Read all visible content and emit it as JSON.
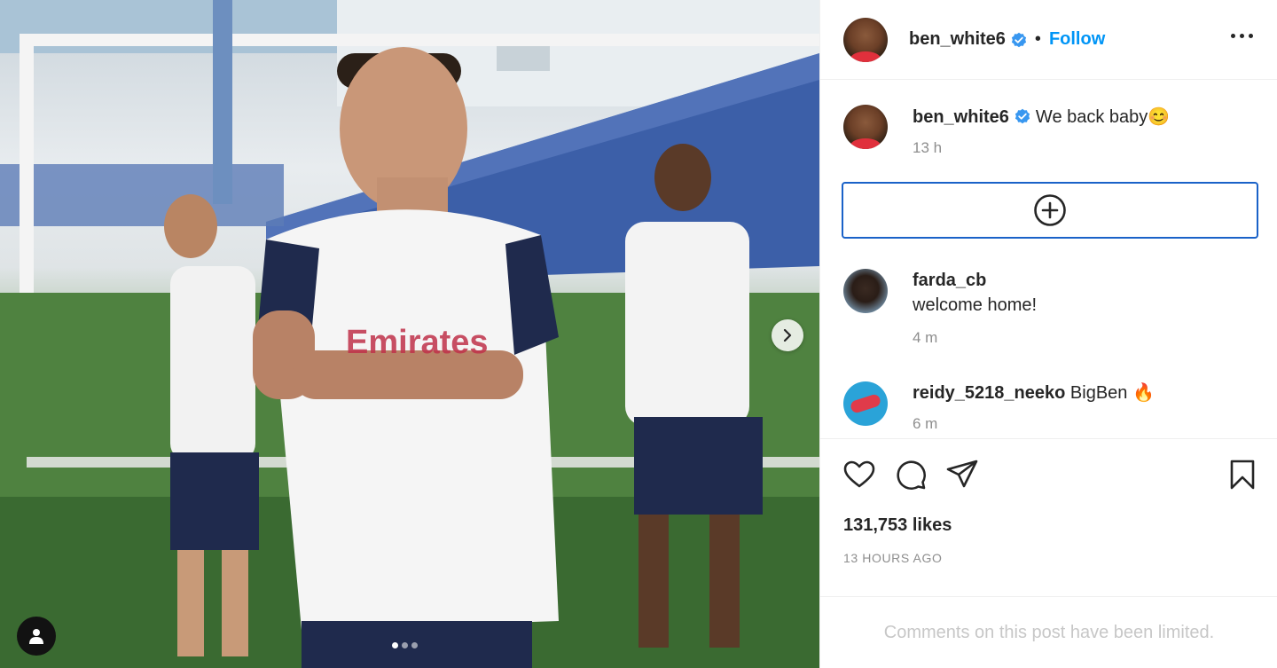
{
  "post": {
    "username": "ben_white6",
    "follow_label": "Follow",
    "separator": "•",
    "caption_text": "We back baby😊",
    "caption_time": "13 h",
    "likes": "131,753 likes",
    "posted_ago": "13 HOURS AGO",
    "comments_limited": "Comments on this post have been limited."
  },
  "carousel": {
    "current_slide": 1,
    "total_slides": 3
  },
  "comments": [
    {
      "username": "farda_cb",
      "text": "welcome home!",
      "time": "4 m"
    },
    {
      "username": "reidy_5218_neeko",
      "text": "BigBen 🔥",
      "time": "6 m"
    }
  ],
  "icons": {
    "verified": "verified-badge-icon",
    "more": "more-options-icon",
    "add": "plus-circle-icon",
    "like": "heart-icon",
    "comment": "comment-bubble-icon",
    "share": "paper-plane-icon",
    "save": "bookmark-icon",
    "next": "chevron-right-icon",
    "tags": "user-tag-icon"
  },
  "colors": {
    "follow_blue": "#0095f6",
    "verified_blue": "#3897f0",
    "add_box_border": "#1a62c8",
    "muted_text": "#8e8e8e"
  }
}
